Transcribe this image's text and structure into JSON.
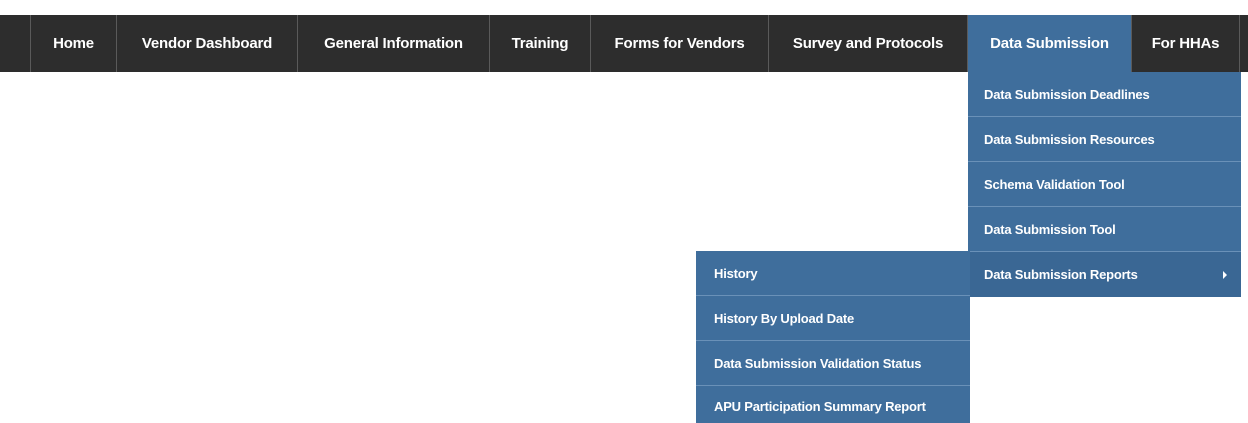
{
  "nav": {
    "items": [
      {
        "label": "Home"
      },
      {
        "label": "Vendor Dashboard"
      },
      {
        "label": "General Information"
      },
      {
        "label": "Training"
      },
      {
        "label": "Forms for Vendors"
      },
      {
        "label": "Survey and Protocols"
      },
      {
        "label": "Data Submission"
      },
      {
        "label": "For HHAs"
      }
    ],
    "active_item": "Data Submission"
  },
  "data_submission_menu": {
    "items": [
      {
        "label": "Data Submission Deadlines"
      },
      {
        "label": "Data Submission Resources"
      },
      {
        "label": "Schema Validation Tool"
      },
      {
        "label": "Data Submission Tool"
      },
      {
        "label": "Data Submission Reports",
        "has_submenu": true
      }
    ]
  },
  "reports_submenu": {
    "items": [
      {
        "label": "History"
      },
      {
        "label": "History By Upload Date"
      },
      {
        "label": "Data Submission Validation Status"
      },
      {
        "label": "APU Participation Summary Report"
      }
    ]
  },
  "colors": {
    "navbar_bg": "#2d2d2d",
    "accent_blue": "#3f6e9c",
    "text": "#ffffff"
  },
  "icons": {
    "submenu_indicator": "caret-right-icon"
  }
}
